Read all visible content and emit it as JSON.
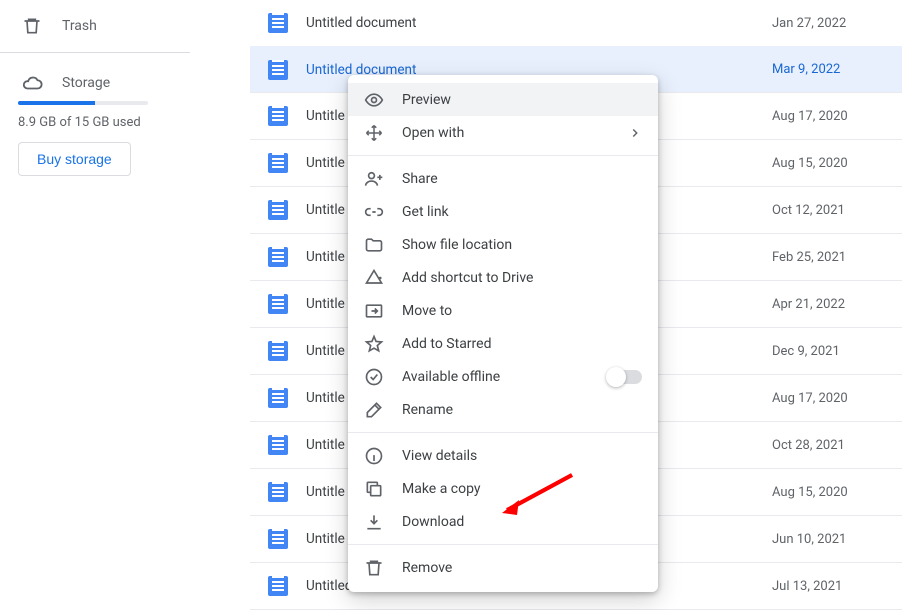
{
  "sidebar": {
    "trash_label": "Trash",
    "storage_label": "Storage",
    "storage_used_text": "8.9 GB of 15 GB used",
    "buy_storage_label": "Buy storage"
  },
  "files": [
    {
      "name": "Untitled document",
      "date": "Jan 27, 2022",
      "selected": false
    },
    {
      "name": "Untitled document",
      "date": "Mar 9, 2022",
      "selected": true
    },
    {
      "name": "Untitled document",
      "date": "Aug 17, 2020",
      "selected": false
    },
    {
      "name": "Untitled document",
      "date": "Aug 15, 2020",
      "selected": false
    },
    {
      "name": "Untitled document",
      "date": "Oct 12, 2021",
      "selected": false
    },
    {
      "name": "Untitled document",
      "date": "Feb 25, 2021",
      "selected": false
    },
    {
      "name": "Untitled document",
      "date": "Apr 21, 2022",
      "selected": false
    },
    {
      "name": "Untitled document",
      "date": "Dec 9, 2021",
      "selected": false
    },
    {
      "name": "Untitled document",
      "date": "Aug 17, 2020",
      "selected": false
    },
    {
      "name": "Untitled document",
      "date": "Oct 28, 2021",
      "selected": false
    },
    {
      "name": "Untitled document",
      "date": "Aug 15, 2020",
      "selected": false
    },
    {
      "name": "Untitled document",
      "date": "Jun 10, 2021",
      "selected": false
    },
    {
      "name": "Untitled document",
      "date": "Jul 13, 2021",
      "selected": false
    }
  ],
  "menu": {
    "preview": "Preview",
    "open_with": "Open with",
    "share": "Share",
    "get_link": "Get link",
    "show_location": "Show file location",
    "add_shortcut": "Add shortcut to Drive",
    "move_to": "Move to",
    "add_starred": "Add to Starred",
    "available_offline": "Available offline",
    "rename": "Rename",
    "view_details": "View details",
    "make_copy": "Make a copy",
    "download": "Download",
    "remove": "Remove"
  },
  "truncated_name": "Untitle"
}
